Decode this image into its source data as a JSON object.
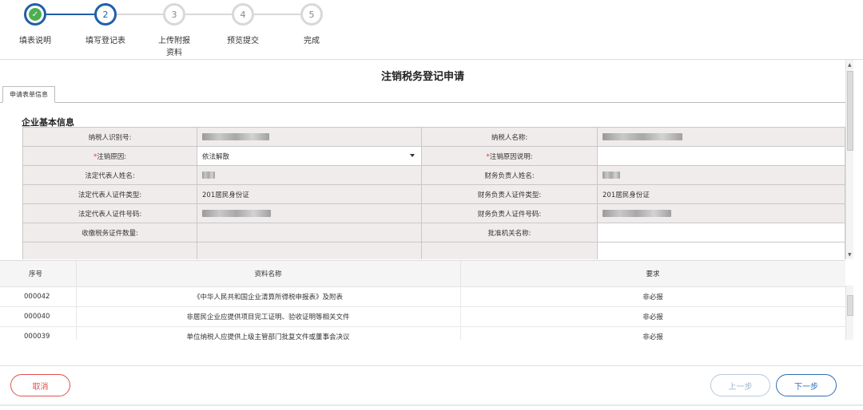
{
  "steps": [
    {
      "number": "",
      "label": "填表说明",
      "state": "done"
    },
    {
      "number": "2",
      "label": "填写登记表",
      "state": "current"
    },
    {
      "number": "3",
      "label": "上传附报资料",
      "state": "todo"
    },
    {
      "number": "4",
      "label": "预览提交",
      "state": "todo"
    },
    {
      "number": "5",
      "label": "完成",
      "state": "todo"
    }
  ],
  "form": {
    "title": "注销税务登记申请",
    "tab_label": "申请表单信息",
    "section_title": "企业基本信息",
    "required_mark": "*",
    "rows": [
      {
        "l1": "纳税人识别号:",
        "v1": "",
        "l2": "纳税人名称:",
        "v2": ""
      },
      {
        "l1": "注销原因:",
        "v1": "依法解散",
        "l2": "注销原因说明:",
        "v2": ""
      },
      {
        "l1": "法定代表人姓名:",
        "v1": "",
        "l2": "财务负责人姓名:",
        "v2": ""
      },
      {
        "l1": "法定代表人证件类型:",
        "v1": "201居民身份证",
        "l2": "财务负责人证件类型:",
        "v2": "201居民身份证"
      },
      {
        "l1": "法定代表人证件号码:",
        "v1": "",
        "l2": "财务负责人证件号码:",
        "v2": ""
      },
      {
        "l1": "收缴税务证件数量:",
        "v1": "",
        "l2": "批准机关名称:",
        "v2": ""
      }
    ]
  },
  "attachments": {
    "headers": {
      "seq": "序号",
      "name": "资料名称",
      "requirement": "要求"
    },
    "rows": [
      {
        "seq": "000042",
        "name": "《中华人民共和国企业清算所得税申报表》及附表",
        "requirement": "非必报"
      },
      {
        "seq": "000040",
        "name": "非居民企业应提供项目完工证明、验收证明等相关文件",
        "requirement": "非必报"
      },
      {
        "seq": "000039",
        "name": "单位纳税人应提供上级主管部门批复文件或董事会决议",
        "requirement": "非必报"
      }
    ]
  },
  "footer": {
    "cancel_label": "取消",
    "prev_label": "上一步",
    "next_label": "下一步"
  },
  "colors": {
    "primary": "#1f5fa8",
    "done_check": "#4caf50",
    "cancel": "#e05050",
    "required": "#ee3333",
    "label_bg": "#f0ecec"
  }
}
